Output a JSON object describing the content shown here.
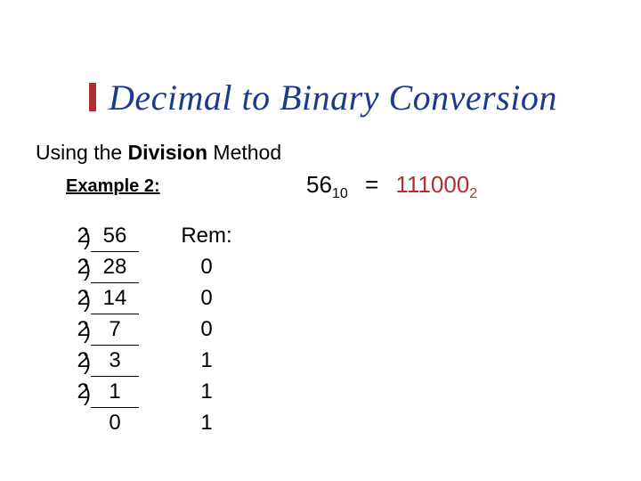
{
  "title": "Decimal to Binary Conversion",
  "subtitle_prefix": "Using the ",
  "subtitle_bold": "Division",
  "subtitle_suffix": " Method",
  "example_label": "Example 2:",
  "equation": {
    "decimal_value": "56",
    "decimal_base": "10",
    "equals": "=",
    "binary_value": "111000",
    "binary_base": "2"
  },
  "work": {
    "rem_header": "Rem:",
    "rows": [
      {
        "divisor": "2",
        "dividend": "56",
        "rem": ""
      },
      {
        "divisor": "2",
        "dividend": "28",
        "rem": "0"
      },
      {
        "divisor": "2",
        "dividend": "14",
        "rem": "0"
      },
      {
        "divisor": "2",
        "dividend": "7",
        "rem": "0"
      },
      {
        "divisor": "2",
        "dividend": "3",
        "rem": "1"
      },
      {
        "divisor": "2",
        "dividend": "1",
        "rem": "1"
      }
    ],
    "final_quotient": "0",
    "final_rem": "1"
  }
}
